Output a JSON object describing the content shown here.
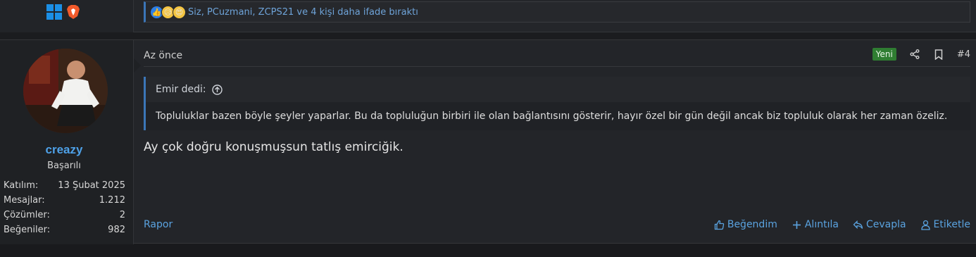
{
  "previous_post": {
    "os_icons": [
      "windows-icon",
      "brave-icon"
    ],
    "reactions": {
      "icons": [
        "like-icon",
        "sad-icon",
        "love-icon"
      ],
      "text": "Siz, PCuzmani, ZCPS21 ve 4 kişi daha ifade bıraktı"
    }
  },
  "post": {
    "user": {
      "username": "creazy",
      "title": "Başarılı",
      "stats": [
        {
          "label": "Katılım:",
          "value": "13 Şubat 2025"
        },
        {
          "label": "Mesajlar:",
          "value": "1.212"
        },
        {
          "label": "Çözümler:",
          "value": "2"
        },
        {
          "label": "Beğeniler:",
          "value": "982"
        }
      ]
    },
    "date": "Az önce",
    "badge": "Yeni",
    "number": "#4",
    "quote": {
      "author": "Emir dedi:",
      "text": "Topluluklar bazen böyle şeyler yaparlar. Bu da topluluğun birbiri ile olan bağlantısını gösterir, hayır özel bir gün değil ancak biz topluluk olarak her zaman özeliz."
    },
    "message": "Ay çok doğru konuşmuşsun tatlış emirciğik.",
    "footer": {
      "report": "Rapor",
      "actions": {
        "like": "Beğendim",
        "quote": "Alıntıla",
        "reply": "Cevapla",
        "mention": "Etiketle"
      }
    }
  },
  "colors": {
    "accent": "#4ea1e8",
    "link": "#5aa3e0",
    "badge_new": "#2f7d32",
    "quote_border": "#3b76b8"
  }
}
